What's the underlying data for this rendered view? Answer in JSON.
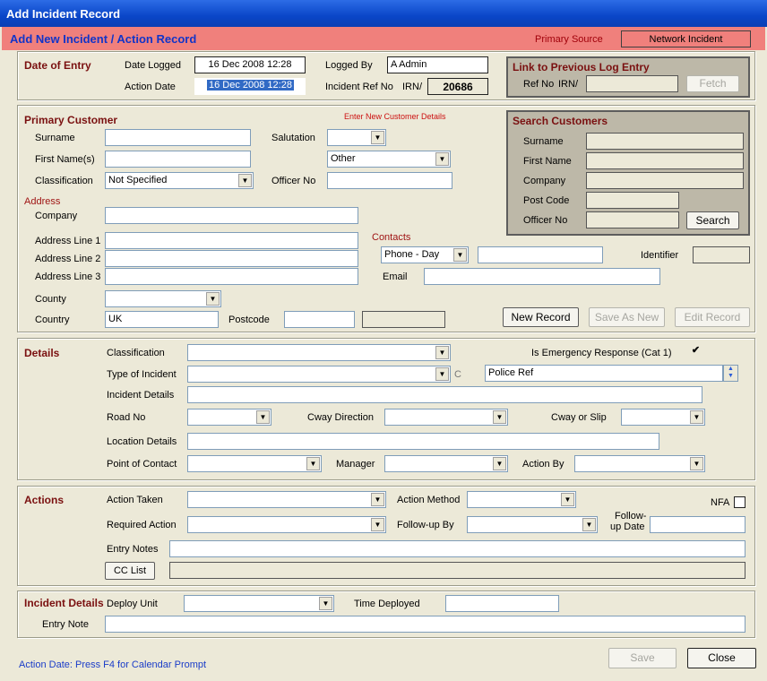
{
  "window": {
    "title": "Add Incident Record"
  },
  "header": {
    "title": "Add New Incident / Action Record",
    "primary_source_label": "Primary Source",
    "primary_source_value": "Network Incident"
  },
  "date_of_entry": {
    "section_title": "Date of Entry",
    "date_logged_label": "Date Logged",
    "date_logged_value": "16 Dec 2008 12:28",
    "action_date_label": "Action Date",
    "action_date_value": "16 Dec 2008 12:28",
    "logged_by_label": "Logged By",
    "logged_by_value": "A Admin",
    "incident_ref_label": "Incident Ref No",
    "irn_label": "IRN/",
    "irn_value": "20686"
  },
  "link_previous": {
    "title": "Link to Previous Log Entry",
    "ref_no_label": "Ref No",
    "irn_label": "IRN/",
    "ref_value": "",
    "fetch_label": "Fetch"
  },
  "primary_customer": {
    "section_title": "Primary Customer",
    "enter_new_label": "Enter New Customer Details",
    "surname_label": "Surname",
    "surname_value": "",
    "first_names_label": "First Name(s)",
    "first_names_value": "",
    "classification_label": "Classification",
    "classification_value": "Not Specified",
    "salutation_label": "Salutation",
    "salutation_value": "",
    "salutation_other_value": "Other",
    "officer_no_label": "Officer No",
    "officer_no_value": "",
    "address_title": "Address",
    "company_label": "Company",
    "company_value": "",
    "address1_label": "Address Line 1",
    "address1_value": "",
    "address2_label": "Address Line 2",
    "address2_value": "",
    "address3_label": "Address Line 3",
    "address3_value": "",
    "county_label": "County",
    "county_value": "",
    "country_label": "Country",
    "country_value": "UK",
    "postcode_label": "Postcode",
    "postcode_value": "",
    "contacts_title": "Contacts",
    "contact_type_value": "Phone - Day",
    "contact_value": "",
    "identifier_label": "Identifier",
    "identifier_value": "",
    "email_label": "Email",
    "email_value": "",
    "new_record_label": "New Record",
    "save_as_new_label": "Save As New",
    "edit_record_label": "Edit Record"
  },
  "search_customers": {
    "title": "Search Customers",
    "surname_label": "Surname",
    "first_name_label": "First Name",
    "company_label": "Company",
    "post_code_label": "Post Code",
    "officer_no_label": "Officer No",
    "search_label": "Search"
  },
  "details": {
    "section_title": "Details",
    "classification_label": "Classification",
    "classification_value": "",
    "emergency_label": "Is Emergency Response (Cat 1)",
    "emergency_check": "✔",
    "type_label": "Type of Incident",
    "type_value": "",
    "c_label": "C",
    "police_ref_value": "Police Ref",
    "incident_details_label": "Incident Details",
    "incident_details_value": "",
    "road_no_label": "Road No",
    "road_no_value": "",
    "cway_direction_label": "Cway Direction",
    "cway_direction_value": "",
    "cway_slip_label": "Cway or Slip",
    "cway_slip_value": "",
    "location_label": "Location Details",
    "location_value": "",
    "poc_label": "Point of Contact",
    "poc_value": "",
    "manager_label": "Manager",
    "manager_value": "",
    "action_by_label": "Action By",
    "action_by_value": ""
  },
  "actions": {
    "section_title": "Actions",
    "action_taken_label": "Action Taken",
    "action_taken_value": "",
    "action_method_label": "Action Method",
    "action_method_value": "",
    "nfa_label": "NFA",
    "required_action_label": "Required Action",
    "required_action_value": "",
    "follow_up_by_label": "Follow-up By",
    "follow_up_by_value": "",
    "follow_up_date_label_1": "Follow-",
    "follow_up_date_label_2": "up Date",
    "follow_up_date_value": "",
    "entry_notes_label": "Entry Notes",
    "entry_notes_value": "",
    "cc_list_label": "CC List",
    "cc_list_value": ""
  },
  "incident_details": {
    "section_title": "Incident Details",
    "deploy_unit_label": "Deploy Unit",
    "deploy_unit_value": "",
    "time_deployed_label": "Time Deployed",
    "time_deployed_value": "",
    "entry_note_label": "Entry Note",
    "entry_note_value": ""
  },
  "footer": {
    "hint": "Action Date:  Press F4 for Calendar Prompt",
    "save_label": "Save",
    "close_label": "Close"
  }
}
